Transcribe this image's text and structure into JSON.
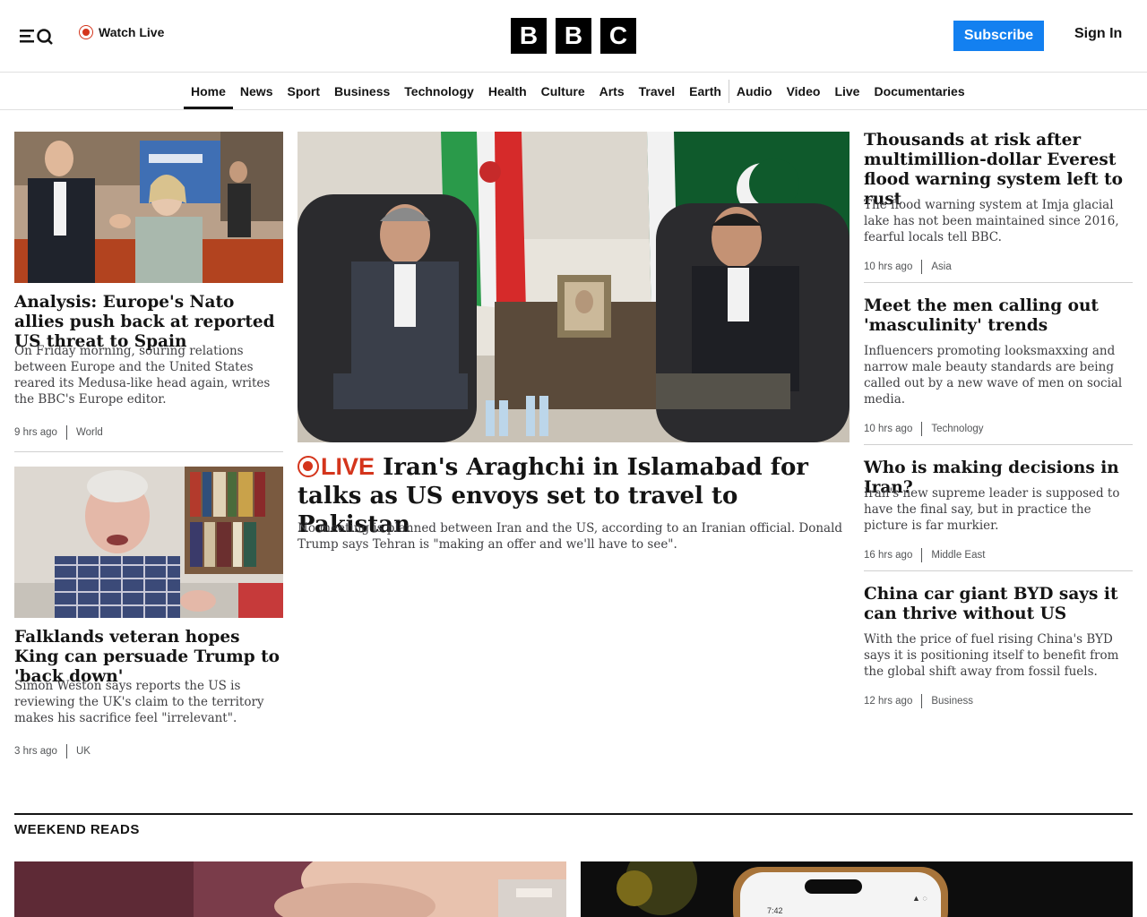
{
  "header": {
    "watch_live": "Watch Live",
    "logo_letters": [
      "B",
      "B",
      "C"
    ],
    "subscribe": "Subscribe",
    "sign_in": "Sign In"
  },
  "nav": {
    "items": [
      "Home",
      "News",
      "Sport",
      "Business",
      "Technology",
      "Health",
      "Culture",
      "Arts",
      "Travel",
      "Earth",
      "Audio",
      "Video",
      "Live",
      "Documentaries"
    ],
    "active": "Home"
  },
  "left_column": [
    {
      "headline": "Analysis: Europe's Nato allies push back at reported US threat to Spain",
      "summary": "On Friday morning, souring relations between Europe and the United States reared its Medusa-like head again, writes the BBC's Europe editor.",
      "time": "9 hrs ago",
      "category": "World"
    },
    {
      "headline": "Falklands veteran hopes King can persuade Trump to 'back down'",
      "summary": "Simon Weston says reports the US is reviewing the UK's claim to the territory makes his sacrifice feel \"irrelevant\".",
      "time": "3 hrs ago",
      "category": "UK"
    }
  ],
  "main_story": {
    "live_label": "LIVE",
    "headline": "Iran's Araghchi in Islamabad for talks as US envoys set to travel to Pakistan",
    "summary": "No meeting is planned between Iran and the US, according to an Iranian official. Donald Trump says Tehran is \"making an offer and we'll have to see\"."
  },
  "right_column": [
    {
      "headline": "Thousands at risk after multimillion-dollar Everest flood warning system left to rust",
      "summary": "The flood warning system at Imja glacial lake has not been maintained since 2016, fearful locals tell BBC.",
      "time": "10 hrs ago",
      "category": "Asia"
    },
    {
      "headline": "Meet the men calling out 'masculinity' trends",
      "summary": "Influencers promoting looksmaxxing and narrow male beauty standards are being called out by a new wave of men on social media.",
      "time": "10 hrs ago",
      "category": "Technology"
    },
    {
      "headline": "Who is making decisions in Iran?",
      "summary": "Iran's new supreme leader is supposed to have the final say, but in practice the picture is far murkier.",
      "time": "16 hrs ago",
      "category": "Middle East"
    },
    {
      "headline": "China car giant BYD says it can thrive without US",
      "summary": "With the price of fuel rising China's BYD says it is positioning itself to benefit from the global shift away from fossil fuels.",
      "time": "12 hrs ago",
      "category": "Business"
    }
  ],
  "weekend_reads": {
    "title": "WEEKEND READS",
    "phone_time": "7:42"
  },
  "colors": {
    "live_red": "#d4351c",
    "subscribe_blue": "#1380f0",
    "text": "#141414"
  }
}
